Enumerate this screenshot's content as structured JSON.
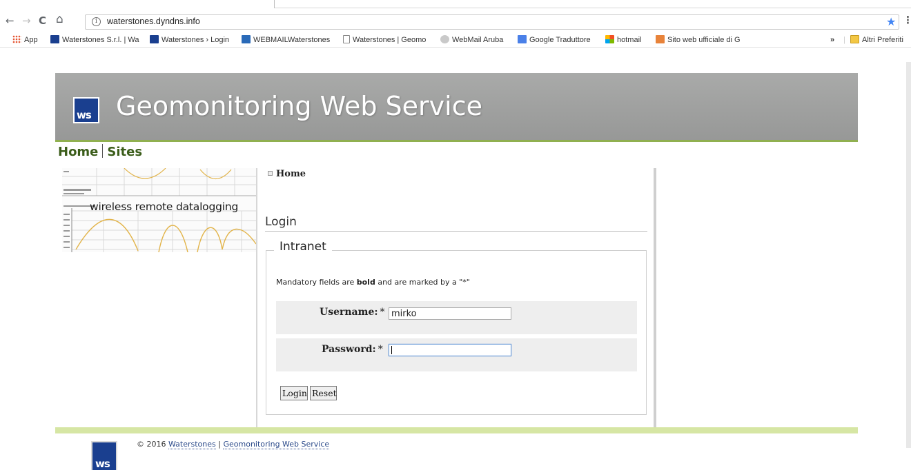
{
  "browser": {
    "url": "waterstones.dyndns.info",
    "back": "←",
    "forward": "→",
    "reload": "C",
    "home": "⌂",
    "info": "i",
    "bookmark_star": "★",
    "menu": "⋮",
    "bookmarks": [
      {
        "label": "App",
        "icon": "apps-icon"
      },
      {
        "label": "Waterstones S.r.l. | Wa",
        "icon": "ws-icon"
      },
      {
        "label": "Waterstones › Login",
        "icon": "ws-icon"
      },
      {
        "label": "WEBMAILWaterstones",
        "icon": "mail-icon"
      },
      {
        "label": "Waterstones | Geomo",
        "icon": "page-icon"
      },
      {
        "label": "WebMail Aruba",
        "icon": "aruba-icon"
      },
      {
        "label": "Google Traduttore",
        "icon": "translate-icon"
      },
      {
        "label": "hotmail",
        "icon": "microsoft-icon"
      },
      {
        "label": "Sito web ufficiale di G",
        "icon": "site-icon"
      }
    ],
    "overflow": "»",
    "other_bookmarks": "Altri Preferiti"
  },
  "header": {
    "logo_text": "ws",
    "title": "Geomonitoring Web Service"
  },
  "nav": {
    "home": "Home",
    "sites": "Sites"
  },
  "banner": {
    "text": "wireless remote datalogging"
  },
  "breadcrumb": {
    "home": "Home"
  },
  "login": {
    "title": "Login",
    "legend": "Intranet",
    "mandatory_pre": "Mandatory fields are ",
    "mandatory_bold": "bold",
    "mandatory_post": " and are marked by a \"*\"",
    "username_label": "Username:",
    "username_value": "mirko",
    "password_label": "Password:",
    "password_value": "",
    "required_mark": "*",
    "login_button": "Login",
    "reset_button": "Reset"
  },
  "footer": {
    "copyright": "© 2016",
    "company": "Waterstones",
    "separator": "|",
    "service": "Geomonitoring Web Service",
    "logo_text": "ws"
  },
  "colors": {
    "nav_green": "#3b5d1a",
    "header_grey": "#a0a1a0",
    "logo_blue": "#1a3f8f",
    "footer_green": "#d6e6a4"
  }
}
